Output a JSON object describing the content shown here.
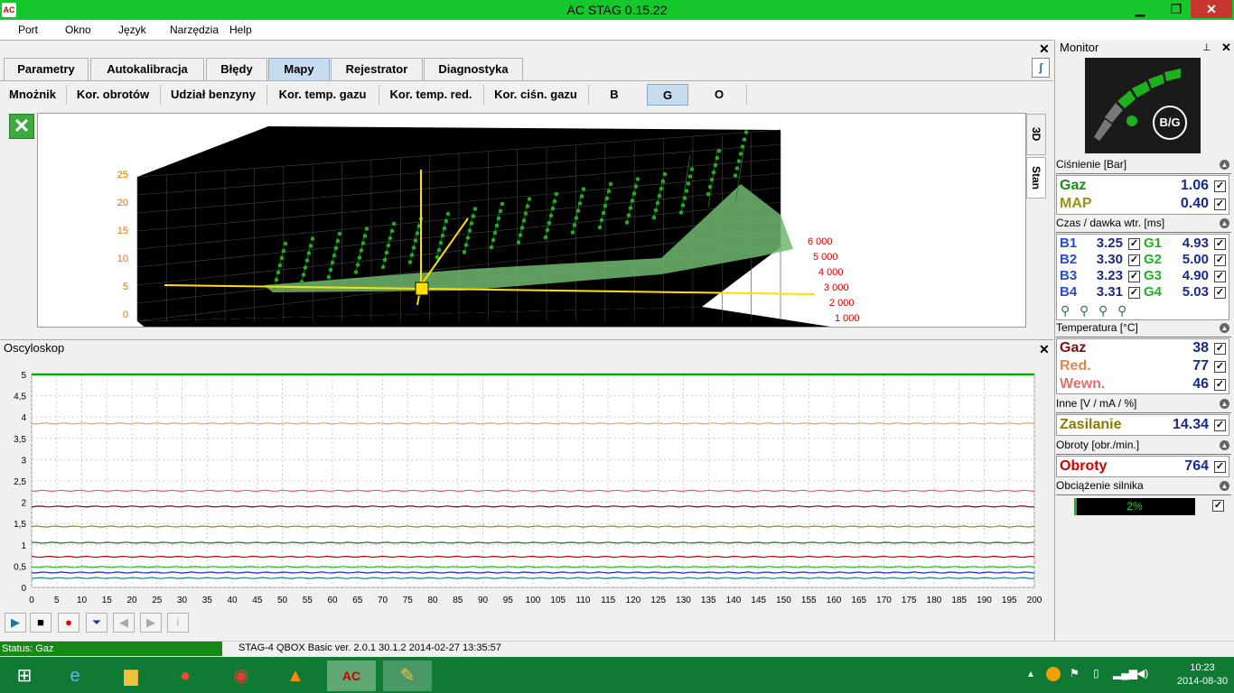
{
  "window": {
    "title": "AC STAG 0.15.22",
    "minimize": "▁",
    "restore": "❐",
    "close": "✕"
  },
  "menu": [
    "Port",
    "Okno",
    "Język",
    "Narzędzia",
    "Help"
  ],
  "tabs": [
    "Parametry",
    "Autokalibracja",
    "Błędy",
    "Mapy",
    "Rejestrator",
    "Diagnostyka"
  ],
  "active_tab": "Mapy",
  "subtabs": [
    "Mnożnik",
    "Kor. obrotów",
    "Udział benzyny",
    "Kor. temp. gazu",
    "Kor. temp. red.",
    "Kor. ciśn. gazu",
    "B",
    "G",
    "O"
  ],
  "active_subtab": "G",
  "side_tabs": [
    "3D",
    "Stan"
  ],
  "plot3d": {
    "z_ticks": [
      "0",
      "5",
      "10",
      "15",
      "20",
      "25"
    ],
    "rpm_ticks": [
      "1 000",
      "2 000",
      "3 000",
      "4 000",
      "5 000",
      "6 000"
    ],
    "colors": {
      "grid": "#000000",
      "surface": "#6fb86f",
      "points": "#22aa22",
      "cursor": "#ffe000",
      "axis_label": "#e07000",
      "rpm_label": "#cc0000"
    }
  },
  "osc": {
    "title": "Oscyloskop",
    "y_ticks": [
      "0",
      "0,5",
      "1",
      "1,5",
      "2",
      "2,5",
      "3",
      "3,5",
      "4",
      "4,5",
      "5"
    ],
    "x_ticks": [
      "0",
      "5",
      "10",
      "15",
      "20",
      "25",
      "30",
      "35",
      "40",
      "45",
      "50",
      "55",
      "60",
      "65",
      "70",
      "75",
      "80",
      "85",
      "90",
      "95",
      "100",
      "105",
      "110",
      "115",
      "120",
      "125",
      "130",
      "135",
      "140",
      "145",
      "150",
      "155",
      "160",
      "165",
      "170",
      "175",
      "180",
      "185",
      "190",
      "195",
      "200"
    ],
    "series": [
      {
        "color": "#e8a060",
        "value": 3.85
      },
      {
        "color": "#e06070",
        "value": 2.27
      },
      {
        "color": "#800020",
        "value": 1.9
      },
      {
        "color": "#a08020",
        "value": 1.43
      },
      {
        "color": "#207020",
        "value": 1.05
      },
      {
        "color": "#c00000",
        "value": 0.72
      },
      {
        "color": "#20c020",
        "value": 0.48
      },
      {
        "color": "#2020e0",
        "value": 0.35
      },
      {
        "color": "#208080",
        "value": 0.22
      },
      {
        "color": "#00b000",
        "value": 5.0
      }
    ]
  },
  "controls": [
    "▶",
    "■",
    "●",
    "⏷",
    "◀",
    "▶",
    "i"
  ],
  "status": {
    "left": "Status: Gaz",
    "version": "STAG-4 QBOX Basic  ver. 2.0.1  30.1.2  2014-02-27 13:35:57"
  },
  "monitor": {
    "title": "Monitor",
    "indicator": "B/G",
    "pressure": {
      "header": "Ciśnienie [Bar]",
      "rows": [
        {
          "label": "Gaz",
          "value": "1.06",
          "color": "#1a8a1a"
        },
        {
          "label": "MAP",
          "value": "0.40",
          "color": "#a09010"
        }
      ]
    },
    "injection": {
      "header": "Czas / dawka wtr. [ms]",
      "rows": [
        {
          "b": "B1",
          "bv": "3.25",
          "g": "G1",
          "gv": "4.93"
        },
        {
          "b": "B2",
          "bv": "3.30",
          "g": "G2",
          "gv": "5.00"
        },
        {
          "b": "B3",
          "bv": "3.23",
          "g": "G3",
          "gv": "4.90"
        },
        {
          "b": "B4",
          "bv": "3.31",
          "g": "G4",
          "gv": "5.03"
        }
      ]
    },
    "temperature": {
      "header": "Temperatura [°C]",
      "rows": [
        {
          "label": "Gaz",
          "value": "38",
          "color": "#7a1010"
        },
        {
          "label": "Red.",
          "value": "77",
          "color": "#e08850"
        },
        {
          "label": "Wewn.",
          "value": "46",
          "color": "#e07070"
        }
      ]
    },
    "other": {
      "header": "Inne [V / mA / %]",
      "label": "Zasilanie",
      "value": "14.34",
      "color": "#8a7a00"
    },
    "rpm": {
      "header": "Obroty [obr./min.]",
      "label": "Obroty",
      "value": "764",
      "color": "#cc0000"
    },
    "load": {
      "header": "Obciążenie silnika",
      "value": "2%",
      "fraction": 0.02
    }
  },
  "taskbar": {
    "time": "10:23",
    "date": "2014-08-30"
  }
}
